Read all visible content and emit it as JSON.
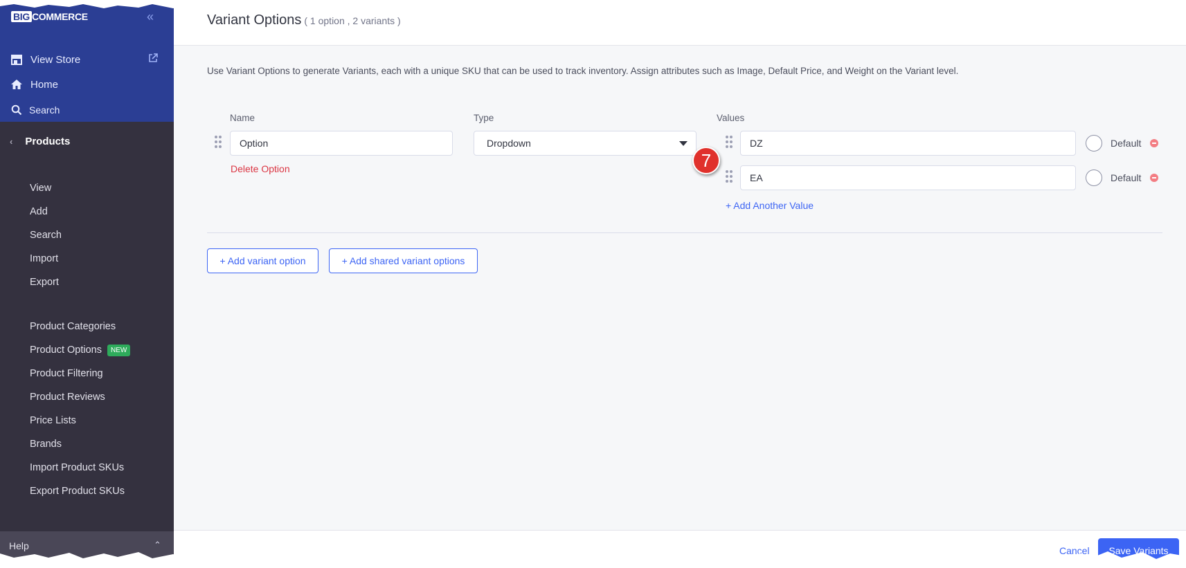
{
  "sidebar": {
    "logo_big": "BIG",
    "logo_rest": "COMMERCE",
    "top_items": [
      {
        "label": "View Store",
        "icon": "store-icon"
      },
      {
        "label": "Home",
        "icon": "home-icon"
      },
      {
        "label": "Search",
        "icon": "search-icon"
      }
    ],
    "section_title": "Products",
    "links_group1": [
      "View",
      "Add",
      "Search",
      "Import",
      "Export"
    ],
    "links_group2": [
      "Product Categories",
      "Product Options",
      "Product Filtering",
      "Product Reviews",
      "Price Lists",
      "Brands",
      "Import Product SKUs",
      "Export Product SKUs"
    ],
    "new_badge": "NEW",
    "help": "Help"
  },
  "header": {
    "title": "Variant Options",
    "subtitle": "( 1 option , 2 variants )"
  },
  "main": {
    "description": "Use Variant Options to generate Variants, each with a unique SKU that can be used to track inventory. Assign attributes such as Image, Default Price, and Weight on the Variant level.",
    "name_label": "Name",
    "type_label": "Type",
    "values_label": "Values",
    "name_value": "Option",
    "type_value": "Dropdown",
    "delete_option": "Delete Option",
    "values": [
      {
        "value": "DZ",
        "default_label": "Default"
      },
      {
        "value": "EA",
        "default_label": "Default"
      }
    ],
    "add_value": "+ Add Another Value",
    "add_variant_option": "+ Add variant option",
    "add_shared_options": "+ Add shared variant options",
    "callout": "7"
  },
  "footer": {
    "cancel": "Cancel",
    "save": "Save Variants"
  },
  "colors": {
    "sidebar_top": "#2b3e94",
    "sidebar": "#34313f",
    "accent": "#3c64f4",
    "danger": "#db3643"
  }
}
